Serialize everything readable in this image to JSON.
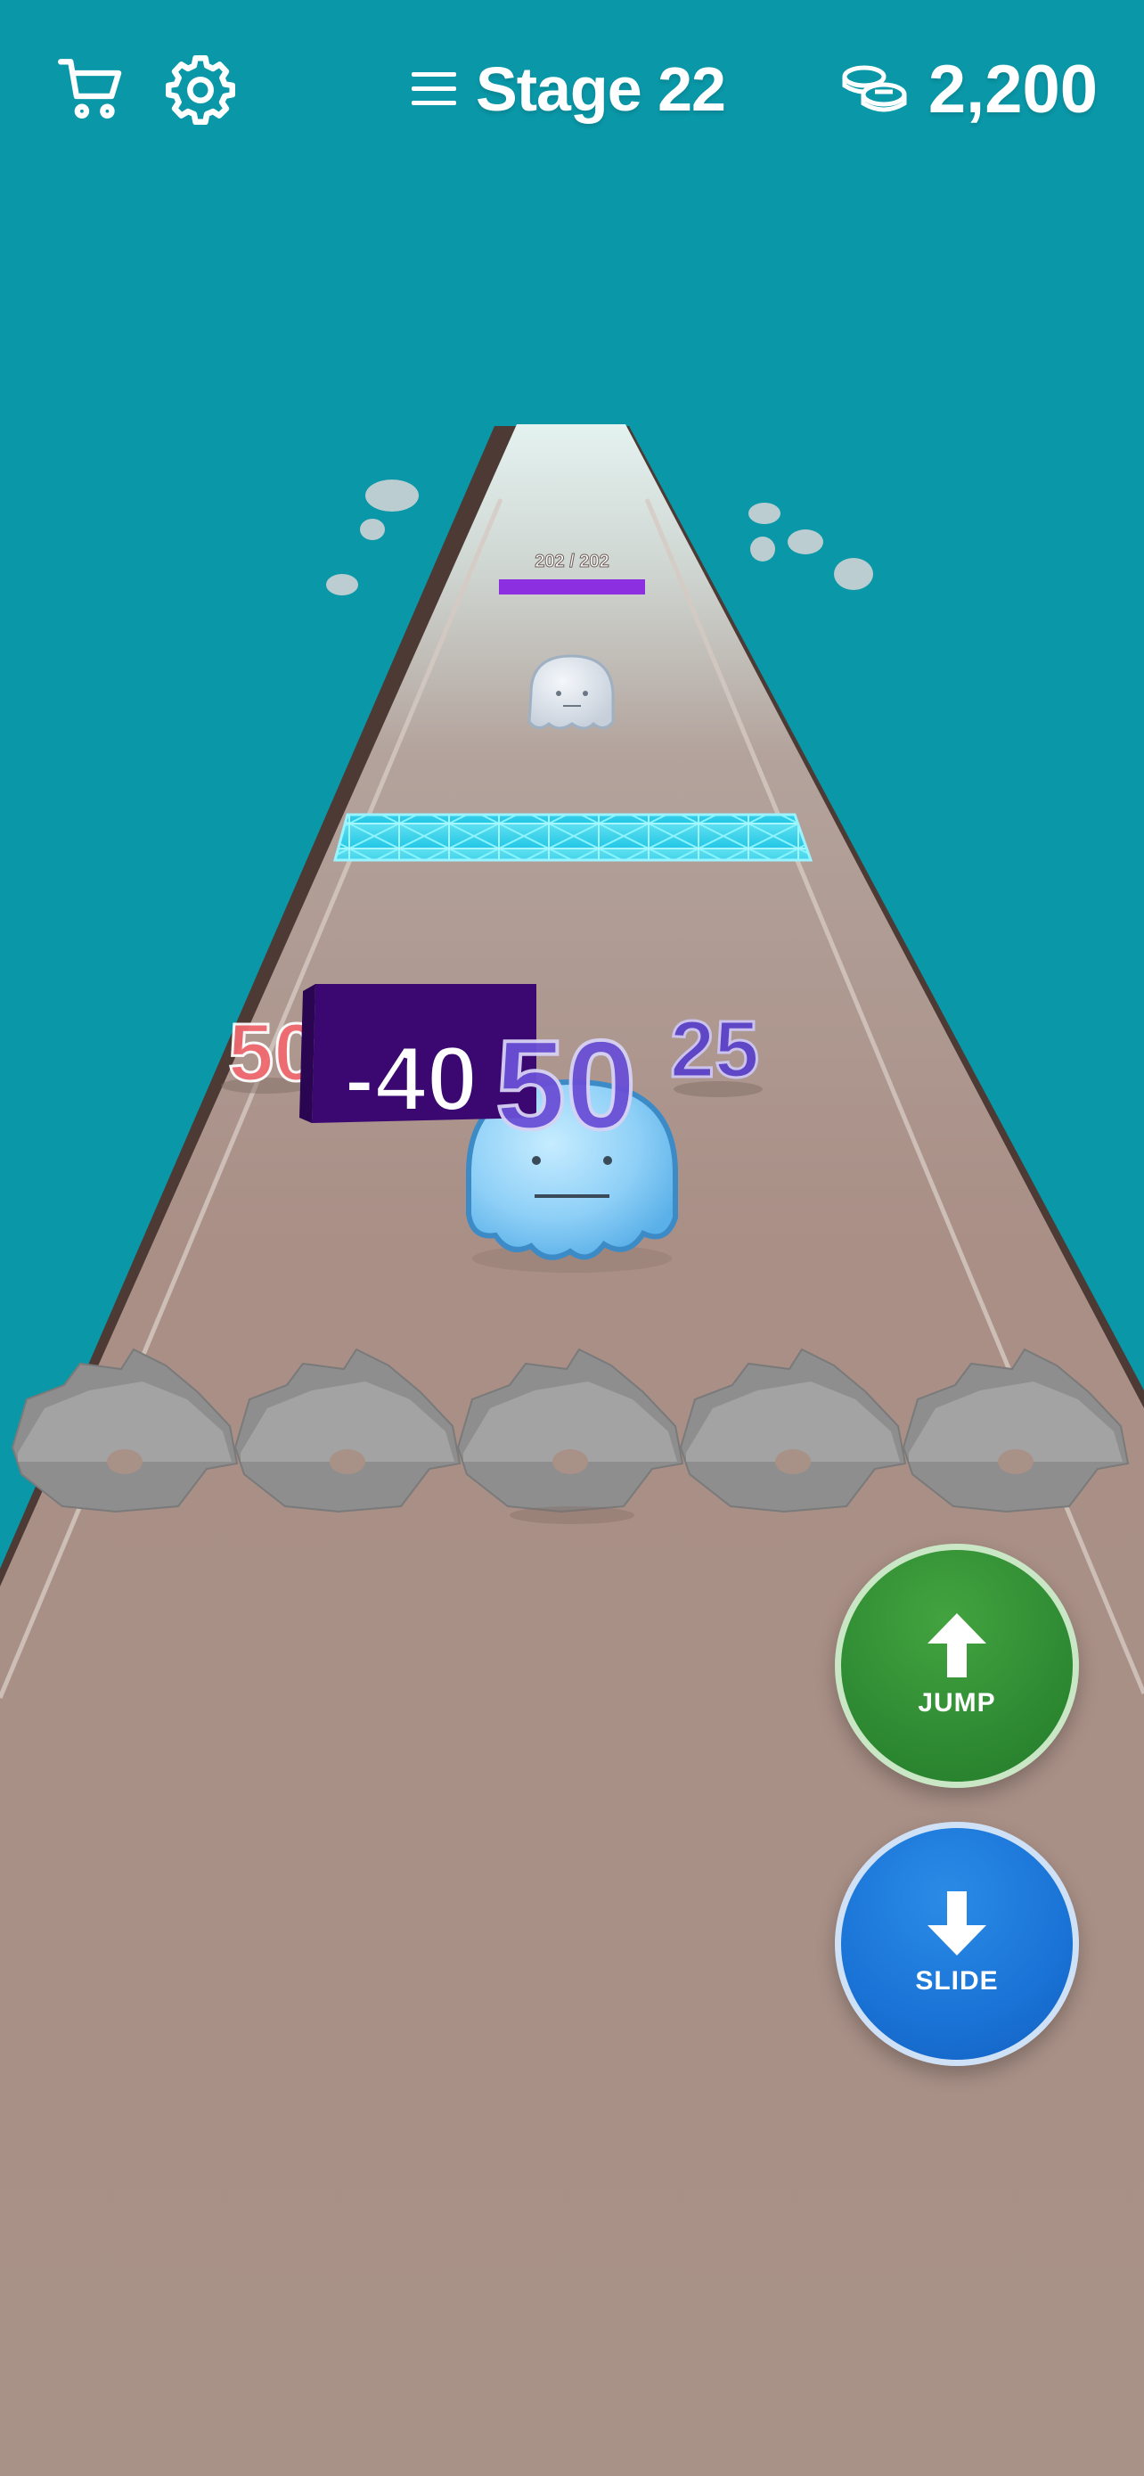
{
  "hud": {
    "cart_icon": "cart-icon",
    "settings_icon": "gear-icon",
    "menu_icon": "hamburger-menu-icon",
    "stage_title": "Stage 22",
    "coin_icon": "coin-stack-icon",
    "coin_amount": "2,200"
  },
  "enemy": {
    "health_text": "202 / 202",
    "health_fraction": 1.0,
    "health_bar_color": "#8b2fe0"
  },
  "track": {
    "gates": [
      {
        "label": "50",
        "color": "#f06a70"
      },
      {
        "label": "-40",
        "color": "#ffffff",
        "box_color": "#3a0870"
      },
      {
        "label": "50",
        "color": "#6a4fd6"
      },
      {
        "label": "25",
        "color": "#5b42c9"
      }
    ]
  },
  "controls": {
    "jump_label": "JUMP",
    "jump_icon": "arrow-up-icon",
    "slide_label": "SLIDE",
    "slide_icon": "arrow-down-icon"
  },
  "colors": {
    "sky": "#0a97a7",
    "road": "#a58f86",
    "jump_button": "#2f8b33",
    "slide_button": "#1a73d6"
  }
}
